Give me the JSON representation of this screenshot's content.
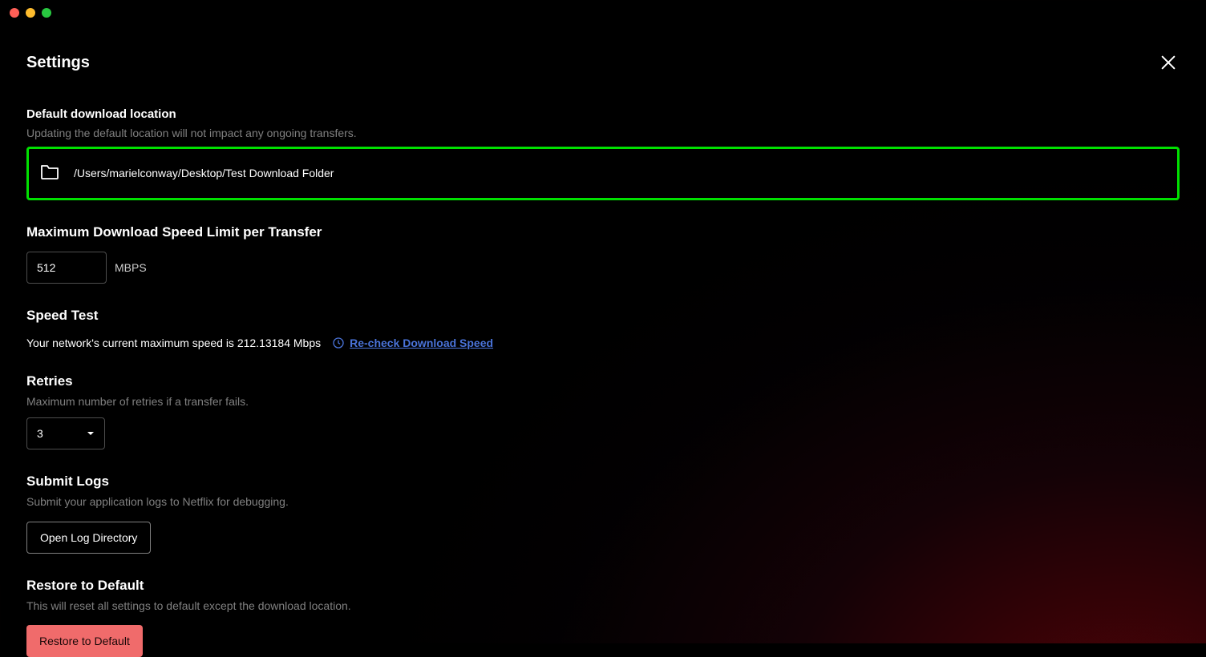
{
  "window": {
    "title": "Settings"
  },
  "download_location": {
    "heading": "Default download location",
    "sub": "Updating the default location will not impact any ongoing transfers.",
    "path": "/Users/marielconway/Desktop/Test Download Folder"
  },
  "speed_limit": {
    "heading": "Maximum Download Speed Limit per Transfer",
    "value": "512",
    "unit": "MBPS"
  },
  "speed_test": {
    "heading": "Speed Test",
    "status": "Your network's current maximum speed is 212.13184 Mbps",
    "recheck_label": "Re-check Download Speed"
  },
  "retries": {
    "heading": "Retries",
    "sub": "Maximum number of retries if a transfer fails.",
    "value": "3"
  },
  "submit_logs": {
    "heading": "Submit Logs",
    "sub": "Submit your application logs to Netflix for debugging.",
    "button": "Open Log Directory"
  },
  "restore": {
    "heading": "Restore to Default",
    "sub": "This will reset all settings to default except the download location.",
    "button": "Restore to Default"
  }
}
